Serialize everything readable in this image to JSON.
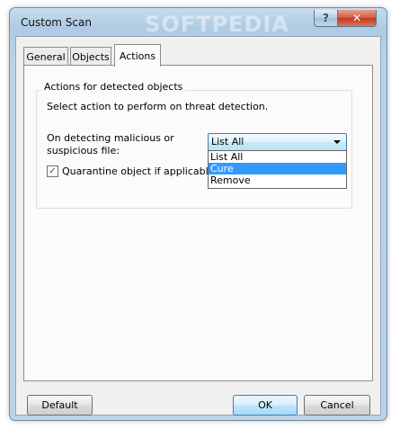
{
  "window": {
    "title": "Custom Scan",
    "watermark": "SOFTPEDIA",
    "help_glyph": "?",
    "close_glyph": "✕"
  },
  "tabs": [
    {
      "label": "General"
    },
    {
      "label": "Objects"
    },
    {
      "label": "Actions",
      "active": true
    }
  ],
  "actions_panel": {
    "group_title": "Actions for detected objects",
    "description": "Select action to perform on threat detection.",
    "detect_label": "On detecting malicious or suspicious file:",
    "combo_value": "List All",
    "dropdown_options": [
      "List All",
      "Cure",
      "Remove"
    ],
    "highlighted_option": "Cure",
    "quarantine_label": "Quarantine object if applicable",
    "quarantine_checked": true
  },
  "buttons": {
    "default_label": "Default",
    "ok_label": "OK",
    "cancel_label": "Cancel"
  },
  "colors": {
    "selection": "#3399ff",
    "titlebar": "#b9d2e8",
    "close_button": "#c0391c"
  }
}
